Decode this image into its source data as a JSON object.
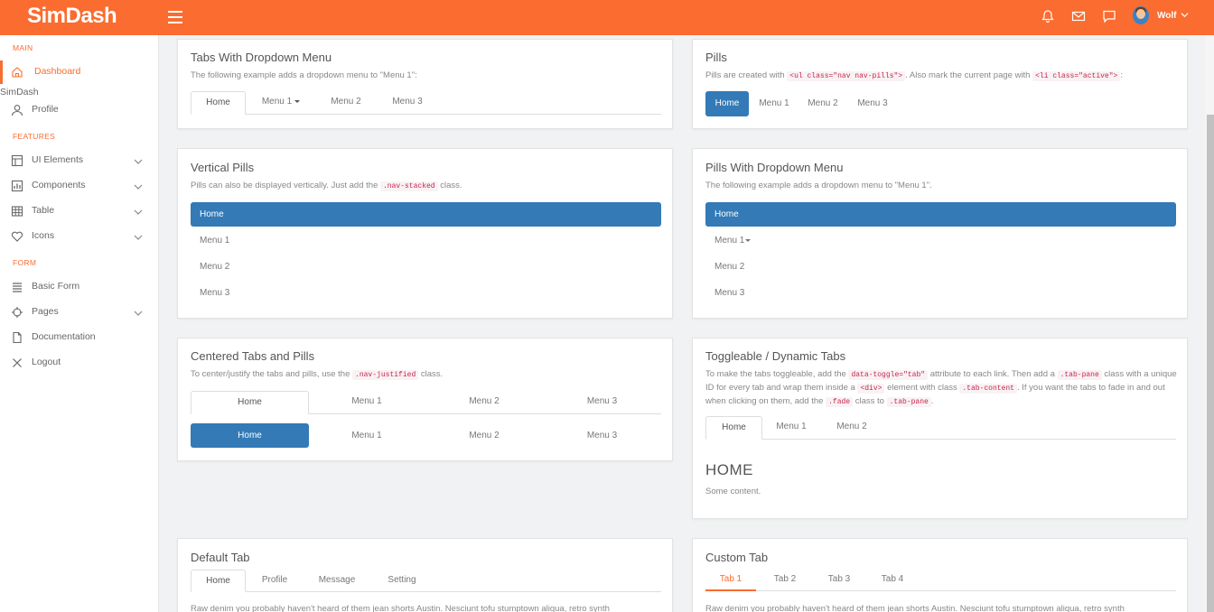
{
  "brand": {
    "name": "SimDash",
    "accent": "#fa6c30"
  },
  "header": {
    "user_name": "Wolf"
  },
  "sidebar": {
    "main_heading": "MAIN",
    "features_heading": "FEATURES",
    "form_heading": "FORM",
    "stray_text": "SimDash",
    "items": [
      {
        "label": "Dashboard",
        "icon": "home-icon"
      },
      {
        "label": "Profile",
        "icon": "user-icon"
      },
      {
        "label": "UI Elements",
        "icon": "layout-icon"
      },
      {
        "label": "Components",
        "icon": "chart-icon"
      },
      {
        "label": "Table",
        "icon": "grid-icon"
      },
      {
        "label": "Icons",
        "icon": "heart-icon"
      },
      {
        "label": "Basic Form",
        "icon": "list-icon"
      },
      {
        "label": "Pages",
        "icon": "crosshair-icon"
      },
      {
        "label": "Documentation",
        "icon": "file-icon"
      },
      {
        "label": "Logout",
        "icon": "x-icon"
      }
    ]
  },
  "cards": {
    "tabs_dropdown": {
      "title": "Tabs With Dropdown Menu",
      "desc": "The following example adds a dropdown menu to \"Menu 1\":",
      "tabs": [
        "Home",
        "Menu 1",
        "Menu 2",
        "Menu 3"
      ]
    },
    "pills": {
      "title": "Pills",
      "desc_1": "Pills are created with",
      "code_1": "<ul class=\"nav nav-pills\">",
      "desc_2": ". Also mark the current page with",
      "code_2": "<li class=\"active\">",
      "desc_3": ":",
      "tabs": [
        "Home",
        "Menu 1",
        "Menu 2",
        "Menu 3"
      ]
    },
    "vertical_pills": {
      "title": "Vertical Pills",
      "desc_1": "Pills can also be displayed vertically. Just add the",
      "code_1": ".nav-stacked",
      "desc_2": "class.",
      "tabs": [
        "Home",
        "Menu 1",
        "Menu 2",
        "Menu 3"
      ]
    },
    "pills_dropdown": {
      "title": "Pills With Dropdown Menu",
      "desc": "The following example adds a dropdown menu to \"Menu 1\".",
      "tabs": [
        "Home",
        "Menu 1",
        "Menu 2",
        "Menu 3"
      ]
    },
    "centered": {
      "title": "Centered Tabs and Pills",
      "desc_1": "To center/justify the tabs and pills, use the",
      "code_1": ".nav-justified",
      "desc_2": "class.",
      "tabs": [
        "Home",
        "Menu 1",
        "Menu 2",
        "Menu 3"
      ],
      "pills": [
        "Home",
        "Menu 1",
        "Menu 2",
        "Menu 3"
      ]
    },
    "toggleable": {
      "title": "Toggleable / Dynamic Tabs",
      "d1": "To make the tabs toggleable, add the",
      "c1": "data-toggle=\"tab\"",
      "d2": "attribute to each link. Then add a",
      "c2": ".tab-pane",
      "d3": "class with a",
      "d4": "unique ID for every tab and wrap them inside a",
      "c3": "<div>",
      "d5": "element with class",
      "c4": ".tab-content",
      "d6": ". If you want the tabs to",
      "d7": "fade in and out when clicking on them, add the",
      "c5": ".fade",
      "d8": "class to",
      "c6": ".tab-pane",
      "d9": ".",
      "tabs": [
        "Home",
        "Menu 1",
        "Menu 2"
      ],
      "pane_title": "HOME",
      "pane_text": "Some content."
    },
    "default_tab": {
      "title": "Default Tab",
      "tabs": [
        "Home",
        "Profile",
        "Message",
        "Setting"
      ],
      "text": "Raw denim you probably haven't heard of them jean shorts Austin. Nesciunt tofu stumptown aliqua, retro synth"
    },
    "custom_tab": {
      "title": "Custom Tab",
      "tabs": [
        "Tab 1",
        "Tab 2",
        "Tab 3",
        "Tab 4"
      ],
      "text": "Raw denim you probably haven't heard of them jean shorts Austin. Nesciunt tofu stumptown aliqua, retro synth"
    }
  }
}
